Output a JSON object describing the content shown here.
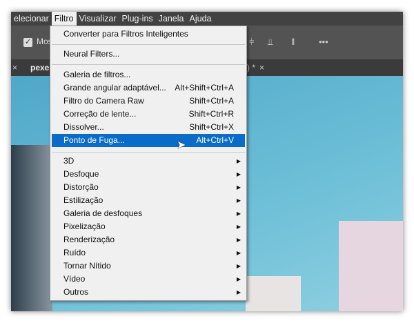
{
  "menubar": [
    "elecionar",
    "Filtro",
    "Visualizar",
    "Plug-ins",
    "Janela",
    "Ajuda"
  ],
  "toolbar": {
    "checkbox_label": "Mos",
    "more": "•••"
  },
  "tabs": {
    "tab1": "pexe",
    "tab2": ") *"
  },
  "menu": {
    "top": [
      {
        "label": "Converter para Filtros Inteligentes"
      }
    ],
    "neural": [
      {
        "label": "Neural Filters..."
      }
    ],
    "filters": [
      {
        "label": "Galeria de filtros...",
        "shortcut": ""
      },
      {
        "label": "Grande angular adaptável...",
        "shortcut": "Alt+Shift+Ctrl+A"
      },
      {
        "label": "Filtro do Camera Raw",
        "shortcut": "Shift+Ctrl+A"
      },
      {
        "label": "Correção de lente...",
        "shortcut": "Shift+Ctrl+R"
      },
      {
        "label": "Dissolver...",
        "shortcut": "Shift+Ctrl+X"
      },
      {
        "label": "Ponto de Fuga...",
        "shortcut": "Alt+Ctrl+V"
      }
    ],
    "submenus": [
      "3D",
      "Desfoque",
      "Distorção",
      "Estilização",
      "Galeria de desfoques",
      "Pixelização",
      "Renderização",
      "Ruído",
      "Tornar Nítido",
      "Vídeo",
      "Outros"
    ]
  },
  "colors": {
    "highlight": "#0a6bc9"
  }
}
